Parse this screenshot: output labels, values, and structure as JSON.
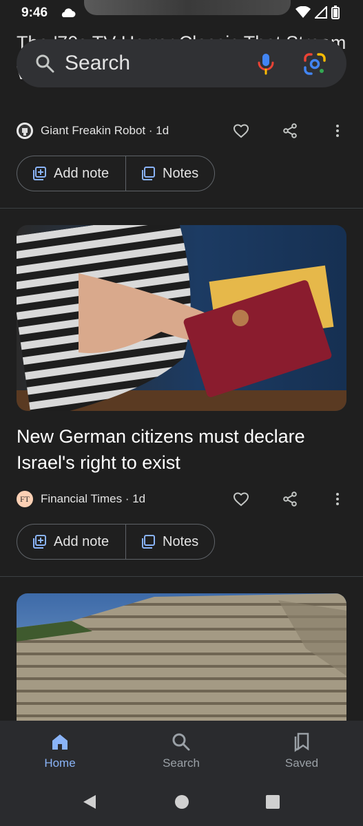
{
  "status": {
    "time": "9:46"
  },
  "search": {
    "label": "Search"
  },
  "articles": [
    {
      "headline": "The '70s TV Horror Classic That Stream Without Netflix",
      "source": "Giant Freakin Robot",
      "age": "· 1d",
      "add_note": "Add note",
      "notes": "Notes"
    },
    {
      "headline": "New German citizens must declare Israel's right to exist",
      "source": "Financial Times",
      "source_avatar_text": "FT",
      "age": "· 1d",
      "add_note": "Add note",
      "notes": "Notes"
    }
  ],
  "bottom_nav": {
    "items": [
      {
        "label": "Home",
        "active": true
      },
      {
        "label": "Search",
        "active": false
      },
      {
        "label": "Saved",
        "active": false
      }
    ]
  },
  "colors": {
    "accent": "#8ab4f8",
    "background": "#1f1f1f",
    "search_bar": "#303134"
  }
}
